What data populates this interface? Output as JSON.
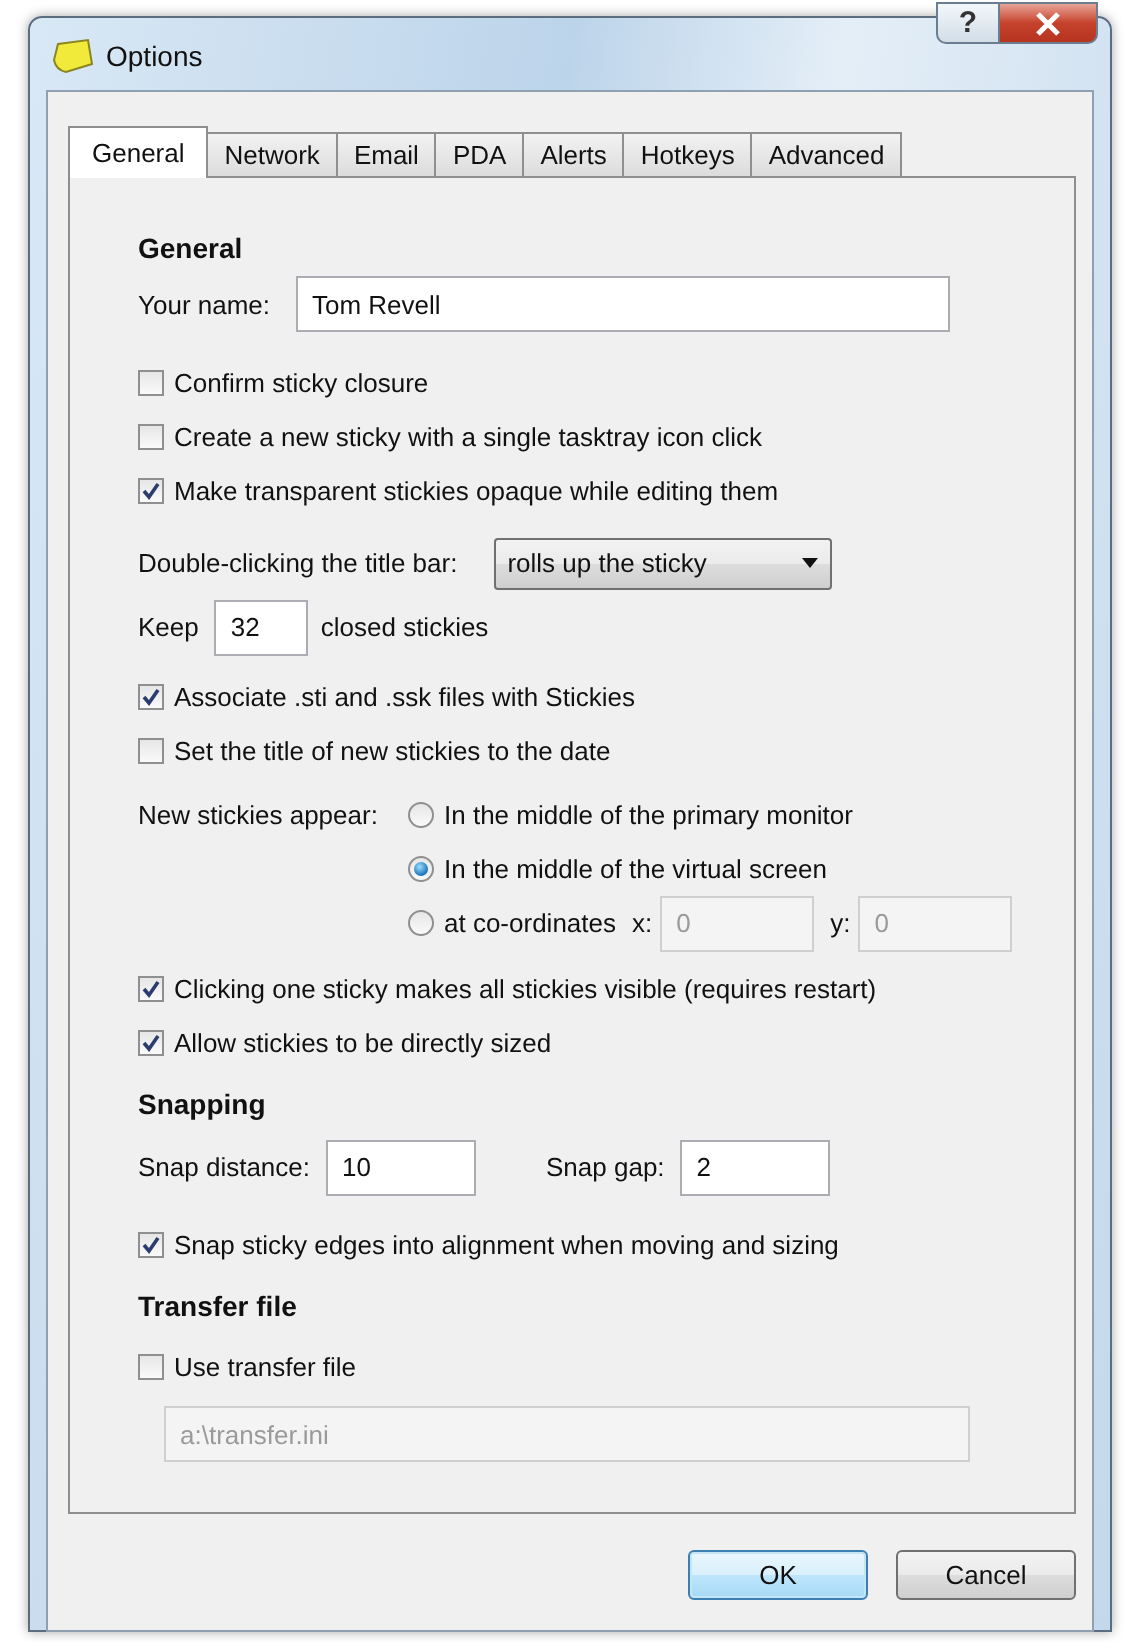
{
  "window": {
    "title": "Options",
    "help_button": "?"
  },
  "tabs": [
    {
      "label": "General",
      "selected": true
    },
    {
      "label": "Network",
      "selected": false
    },
    {
      "label": "Email",
      "selected": false
    },
    {
      "label": "PDA",
      "selected": false
    },
    {
      "label": "Alerts",
      "selected": false
    },
    {
      "label": "Hotkeys",
      "selected": false
    },
    {
      "label": "Advanced",
      "selected": false
    }
  ],
  "rows": [
    {
      "kind": "heading",
      "text": "General"
    },
    {
      "kind": "labeled_field",
      "label": "Your name:",
      "value": "Tom Revell",
      "disabled": false
    },
    {
      "kind": "checkbox",
      "label": "Confirm sticky closure",
      "checked": false
    },
    {
      "kind": "checkbox",
      "label": "Create a new sticky with a single tasktray icon click",
      "checked": false
    },
    {
      "kind": "checkbox",
      "label": "Make transparent stickies opaque while editing them",
      "checked": true
    },
    {
      "kind": "dropdown",
      "label": "Double-clicking the title bar:",
      "value": "rolls up the sticky"
    },
    {
      "kind": "inline_field",
      "before": "Keep",
      "value": "32",
      "after": "closed stickies",
      "disabled": false
    },
    {
      "kind": "checkbox",
      "label": "Associate .sti and .ssk files with Stickies",
      "checked": true
    },
    {
      "kind": "checkbox",
      "label": "Set the title of new stickies to the date",
      "checked": false
    },
    {
      "kind": "radio_group",
      "label": "New stickies appear:",
      "options": [
        {
          "label": "In the middle of the primary monitor",
          "selected": false
        },
        {
          "label": "In the middle of the virtual screen",
          "selected": true
        },
        {
          "label": "at co-ordinates",
          "selected": false,
          "fields": [
            {
              "label": "x:",
              "value": "0",
              "disabled": true
            },
            {
              "label": "y:",
              "value": "0",
              "disabled": true
            }
          ]
        }
      ]
    },
    {
      "kind": "checkbox",
      "label": "Clicking one sticky makes all stickies visible (requires restart)",
      "checked": true
    },
    {
      "kind": "checkbox",
      "label": "Allow stickies to be directly sized",
      "checked": true
    },
    {
      "kind": "heading",
      "text": "Snapping"
    },
    {
      "kind": "field_pair",
      "fields": [
        {
          "label": "Snap distance:",
          "value": "10",
          "disabled": false
        },
        {
          "label": "Snap gap:",
          "value": "2",
          "disabled": false
        }
      ]
    },
    {
      "kind": "checkbox",
      "label": "Snap sticky edges into alignment when moving and sizing",
      "checked": true
    },
    {
      "kind": "heading",
      "text": "Transfer file"
    },
    {
      "kind": "checkbox",
      "label": "Use transfer file",
      "checked": false
    },
    {
      "kind": "field",
      "value": "a:\\transfer.ini",
      "disabled": true
    }
  ],
  "buttons": [
    {
      "label": "OK",
      "default": true
    },
    {
      "label": "Cancel",
      "default": false
    }
  ]
}
